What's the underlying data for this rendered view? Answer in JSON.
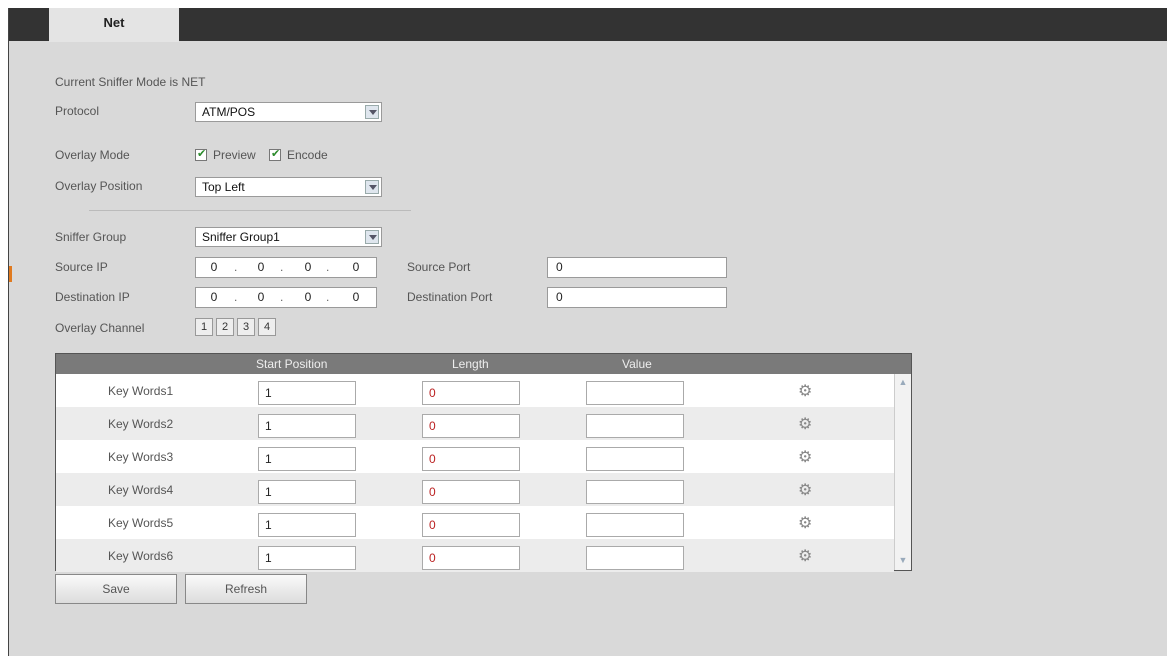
{
  "tab": {
    "label": "Net"
  },
  "sniffer_mode_text": "Current Sniffer Mode is NET",
  "protocol": {
    "label": "Protocol",
    "value": "ATM/POS"
  },
  "overlay_mode": {
    "label": "Overlay Mode",
    "preview_label": "Preview",
    "encode_label": "Encode",
    "preview_checked": true,
    "encode_checked": true
  },
  "overlay_position": {
    "label": "Overlay Position",
    "value": "Top Left"
  },
  "sniffer_group": {
    "label": "Sniffer Group",
    "value": "Sniffer Group1"
  },
  "source_ip": {
    "label": "Source IP",
    "octets": [
      "0",
      "0",
      "0",
      "0"
    ]
  },
  "source_port": {
    "label": "Source Port",
    "value": "0"
  },
  "destination_ip": {
    "label": "Destination IP",
    "octets": [
      "0",
      "0",
      "0",
      "0"
    ]
  },
  "destination_port": {
    "label": "Destination Port",
    "value": "0"
  },
  "overlay_channel": {
    "label": "Overlay Channel",
    "channels": [
      "1",
      "2",
      "3",
      "4"
    ]
  },
  "table": {
    "headers": {
      "start_position": "Start Position",
      "length": "Length",
      "value": "Value"
    },
    "rows": [
      {
        "name": "Key Words1",
        "start": "1",
        "length": "0",
        "value": ""
      },
      {
        "name": "Key Words2",
        "start": "1",
        "length": "0",
        "value": ""
      },
      {
        "name": "Key Words3",
        "start": "1",
        "length": "0",
        "value": ""
      },
      {
        "name": "Key Words4",
        "start": "1",
        "length": "0",
        "value": ""
      },
      {
        "name": "Key Words5",
        "start": "1",
        "length": "0",
        "value": ""
      },
      {
        "name": "Key Words6",
        "start": "1",
        "length": "0",
        "value": ""
      }
    ],
    "settings_icon": "gear-icon"
  },
  "buttons": {
    "save": "Save",
    "refresh": "Refresh"
  },
  "colors": {
    "tab_bar": "#333333",
    "panel": "#d9d9d9",
    "table_header": "#7a7a7a",
    "length_text": "#b22222"
  }
}
